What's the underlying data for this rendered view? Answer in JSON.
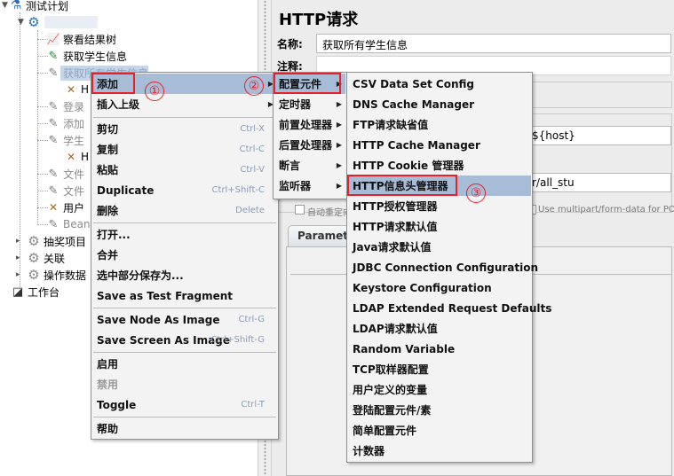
{
  "tree": {
    "root_label": "测试计划",
    "items": {
      "view_results": "察看结果树",
      "get_student": "获取学生信息",
      "get_all_students": "获取所有学生信息",
      "login": "登录",
      "add": "添加",
      "student": "学生",
      "h_child": "H",
      "file1": "文件",
      "file2": "文件",
      "user": "用户",
      "bean": "Bean",
      "lottery": "抽奖项目",
      "follow": "关联",
      "data_op": "操作数据",
      "workbench": "工作台"
    }
  },
  "panel": {
    "title": "HTTP请求",
    "name_label": "名称:",
    "name_value": "获取所有学生信息",
    "comment_label": "注释:",
    "host_value": "${host}",
    "path_value": "r/all_stu",
    "auto_redirect_label": "自动重定向",
    "multipart_label": "Use multipart/form-data for POST",
    "params_tab": "Paramete"
  },
  "menu1": {
    "items": [
      {
        "label": "添加",
        "accel": "",
        "submenu": true
      },
      {
        "label": "插入上级",
        "accel": "",
        "submenu": true
      },
      {
        "label": "剪切",
        "accel": "Ctrl-X"
      },
      {
        "label": "复制",
        "accel": "Ctrl-C"
      },
      {
        "label": "粘贴",
        "accel": "Ctrl-V"
      },
      {
        "label": "Duplicate",
        "accel": "Ctrl+Shift-C"
      },
      {
        "label": "删除",
        "accel": "Delete"
      },
      {
        "label": "打开...",
        "accel": ""
      },
      {
        "label": "合并",
        "accel": ""
      },
      {
        "label": "选中部分保存为...",
        "accel": ""
      },
      {
        "label": "Save as Test Fragment",
        "accel": ""
      },
      {
        "label": "Save Node As Image",
        "accel": "Ctrl-G"
      },
      {
        "label": "Save Screen As Image",
        "accel": "Ctrl+Shift-G"
      },
      {
        "label": "启用",
        "accel": ""
      },
      {
        "label": "禁用",
        "accel": "",
        "disabled": true
      },
      {
        "label": "Toggle",
        "accel": "Ctrl-T"
      },
      {
        "label": "帮助",
        "accel": ""
      }
    ]
  },
  "menu2": {
    "items": [
      {
        "label": "配置元件"
      },
      {
        "label": "定时器"
      },
      {
        "label": "前置处理器"
      },
      {
        "label": "后置处理器"
      },
      {
        "label": "断言"
      },
      {
        "label": "监听器"
      }
    ]
  },
  "menu3": {
    "items": [
      "CSV Data Set Config",
      "DNS Cache Manager",
      "FTP请求缺省值",
      "HTTP Cache Manager",
      "HTTP Cookie 管理器",
      "HTTP信息头管理器",
      "HTTP授权管理器",
      "HTTP请求默认值",
      "Java请求默认值",
      "JDBC Connection Configuration",
      "Keystore Configuration",
      "LDAP Extended Request Defaults",
      "LDAP请求默认值",
      "Random Variable",
      "TCP取样器配置",
      "用户定义的变量",
      "登陆配置元件/素",
      "简单配置元件",
      "计数器"
    ]
  },
  "annotations": {
    "step1": "①",
    "step2": "②",
    "step3": "③",
    "color": "#e8202a"
  },
  "colors": {
    "highlight": "#a7bcd6",
    "menu_bg": "#f3f3f3",
    "panel_bg": "#ececec"
  }
}
